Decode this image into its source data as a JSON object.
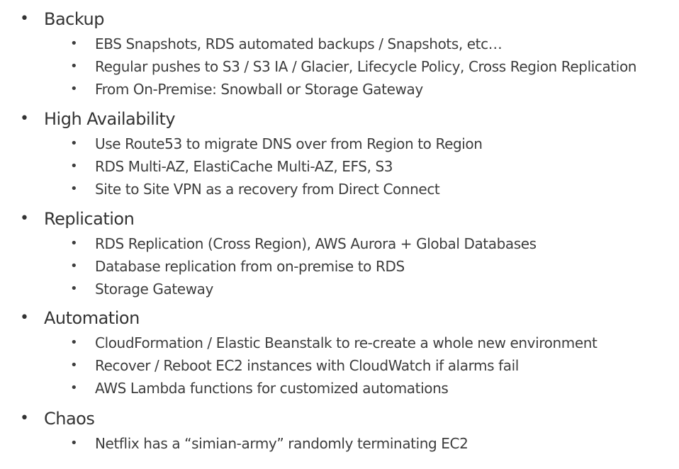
{
  "sections": [
    {
      "heading": "Backup",
      "items": [
        "EBS Snapshots, RDS automated backups / Snapshots, etc…",
        "Regular pushes to S3 / S3 IA / Glacier, Lifecycle Policy, Cross Region Replication",
        "From On-Premise: Snowball or Storage Gateway"
      ]
    },
    {
      "heading": "High Availability",
      "items": [
        "Use Route53 to migrate DNS over from Region to Region",
        "RDS Multi-AZ, ElastiCache Multi-AZ, EFS, S3",
        "Site to Site VPN as a recovery from Direct Connect"
      ]
    },
    {
      "heading": "Replication",
      "items": [
        "RDS Replication (Cross Region), AWS Aurora + Global Databases",
        "Database replication from on-premise to RDS",
        "Storage Gateway"
      ]
    },
    {
      "heading": "Automation",
      "items": [
        "CloudFormation / Elastic Beanstalk to re-create a whole new environment",
        "Recover / Reboot EC2 instances with CloudWatch if alarms fail",
        "AWS Lambda functions for customized automations"
      ]
    },
    {
      "heading": "Chaos",
      "items": [
        "Netflix has a “simian-army” randomly terminating EC2"
      ]
    }
  ],
  "bullet_glyph": "•"
}
